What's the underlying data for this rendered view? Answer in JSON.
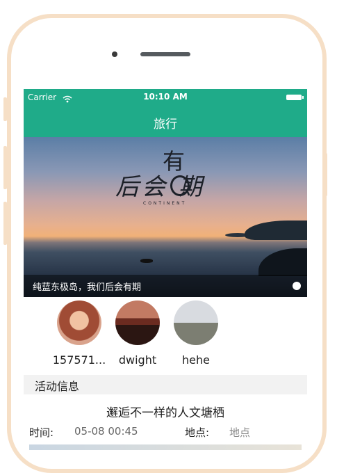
{
  "status_bar": {
    "carrier": "Carrier",
    "time": "10:10 AM"
  },
  "nav": {
    "title": "旅行"
  },
  "banner": {
    "logo_top": "有",
    "logo_main": "后会  期",
    "logo_sub": "CONTINENT",
    "caption": "纯蓝东极岛，我们后会有期"
  },
  "members": [
    {
      "name": "157571..."
    },
    {
      "name": "dwight"
    },
    {
      "name": "hehe"
    }
  ],
  "section": {
    "title": "活动信息"
  },
  "activity": {
    "title": "邂逅不一样的人文塘栖",
    "time_label": "时间:",
    "time_value": "05-08 00:45",
    "location_label": "地点:",
    "location_value": "地点"
  },
  "colors": {
    "accent": "#1fab89",
    "frame": "#f6dfc6"
  },
  "icons": {
    "wifi": "wifi-icon",
    "battery": "battery-icon"
  }
}
